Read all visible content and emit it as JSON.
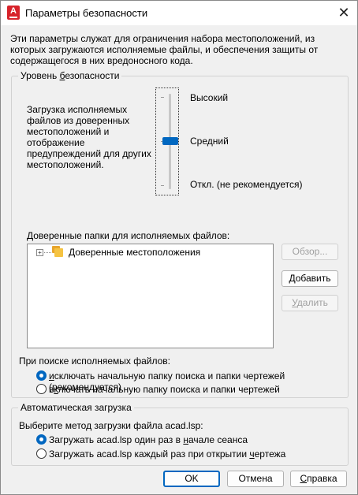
{
  "window": {
    "title": "Параметры безопасности",
    "app_icon_letter": "A",
    "close_glyph": "✕"
  },
  "intro_text": "Эти параметры служат для ограничения набора местоположений, из которых загружаются исполняемые файлы, и обеспечения защиты от содержащегося в них вредоносного кода.",
  "security_level": {
    "group_title_pre": "Уровень ",
    "group_title_u": "б",
    "group_title_post": "езопасности",
    "description": "Загрузка исполняемых файлов из доверенных местоположений и отображение предупреждений для других местоположений.",
    "levels": [
      "Высокий",
      "Средний",
      "Откл. (не рекомендуется)"
    ],
    "selected_level": "Средний",
    "trusted_folders_label": "Доверенные папки для исполняемых файлов:",
    "tree_items": [
      {
        "label": "Доверенные местоположения",
        "icon": "folder-icon",
        "expander": "+"
      }
    ],
    "buttons": {
      "browse": "Обзор...",
      "add_pre": "",
      "add_u": "Д",
      "add_post": "обавить",
      "remove_pre": "",
      "remove_u": "У",
      "remove_post": "далить"
    },
    "search_label": "При поиске исполняемых файлов:",
    "search_options": [
      {
        "pre": "",
        "u": "и",
        "post": "сключать начальную папку поиска и папки чертежей (рекомендуется)",
        "selected": true
      },
      {
        "pre": "в",
        "u": "к",
        "post": "лючать начальную папку поиска и папки чертежей",
        "selected": false
      }
    ]
  },
  "auto_load": {
    "group_title": "Автоматическая загрузка",
    "method_label": "Выберите метод загрузки файла acad.lsp:",
    "options": [
      {
        "pre": "Загружать acad.lsp один раз в ",
        "u": "н",
        "post": "ачале сеанса",
        "selected": true
      },
      {
        "pre": "Загружать acad.lsp каждый раз при открытии ",
        "u": "ч",
        "post": "ертежа",
        "selected": false
      }
    ]
  },
  "footer": {
    "ok": "OK",
    "cancel": "Отмена",
    "help_pre": "",
    "help_u": "С",
    "help_post": "правка"
  },
  "colors": {
    "accent": "#0067c0",
    "app_icon": "#d7222a",
    "folder": "#f5c342"
  }
}
